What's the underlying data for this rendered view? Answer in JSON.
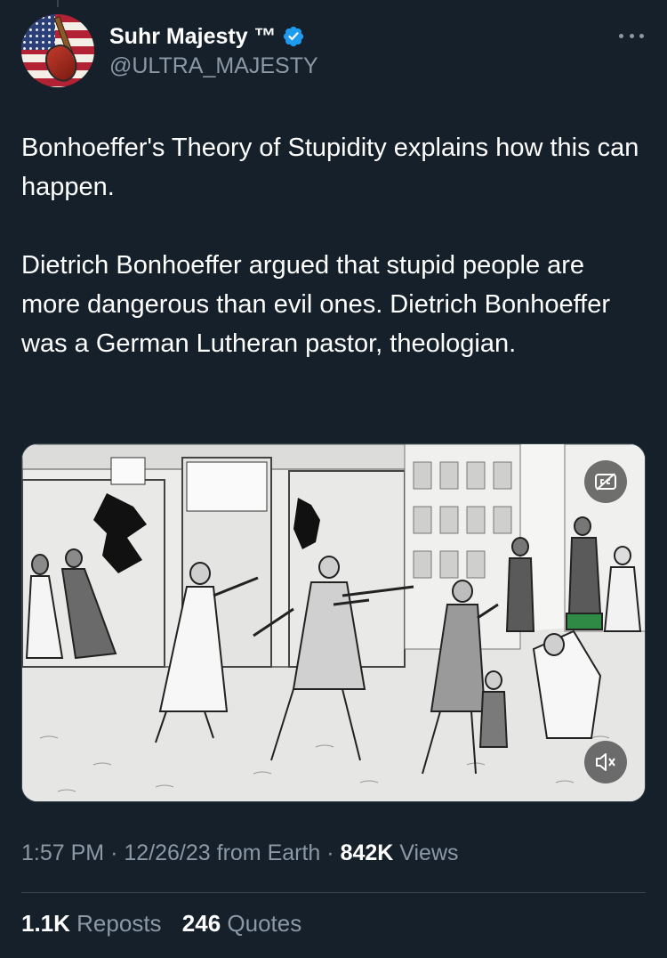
{
  "author": {
    "display_name": "Suhr Majesty ™",
    "handle": "@ULTRA_MAJESTY",
    "verified": true,
    "avatar_icon": "american-flag-guitar-avatar",
    "verified_color": "#1d9bf0"
  },
  "tweet": {
    "paragraph_1": "Bonhoeffer's Theory of Stupidity explains how this can happen.",
    "paragraph_2": "Dietrich Bonhoeffer argued that stupid people are more dangerous than evil ones. Dietrich Bonhoeffer was a German Lutheran pastor, theologian."
  },
  "media": {
    "type": "video",
    "captions_icon": "closed-captions-icon",
    "mute_icon": "speaker-muted-icon"
  },
  "meta": {
    "time": "1:57 PM",
    "separator": "·",
    "date": "12/26/23",
    "source": "from Earth",
    "views_count": "842K",
    "views_label": "Views"
  },
  "stats": {
    "reposts_count": "1.1K",
    "reposts_label": "Reposts",
    "quotes_count": "246",
    "quotes_label": "Quotes"
  },
  "colors": {
    "background": "#15202b",
    "secondary_text": "#8b98a5",
    "divider": "#38444d"
  }
}
